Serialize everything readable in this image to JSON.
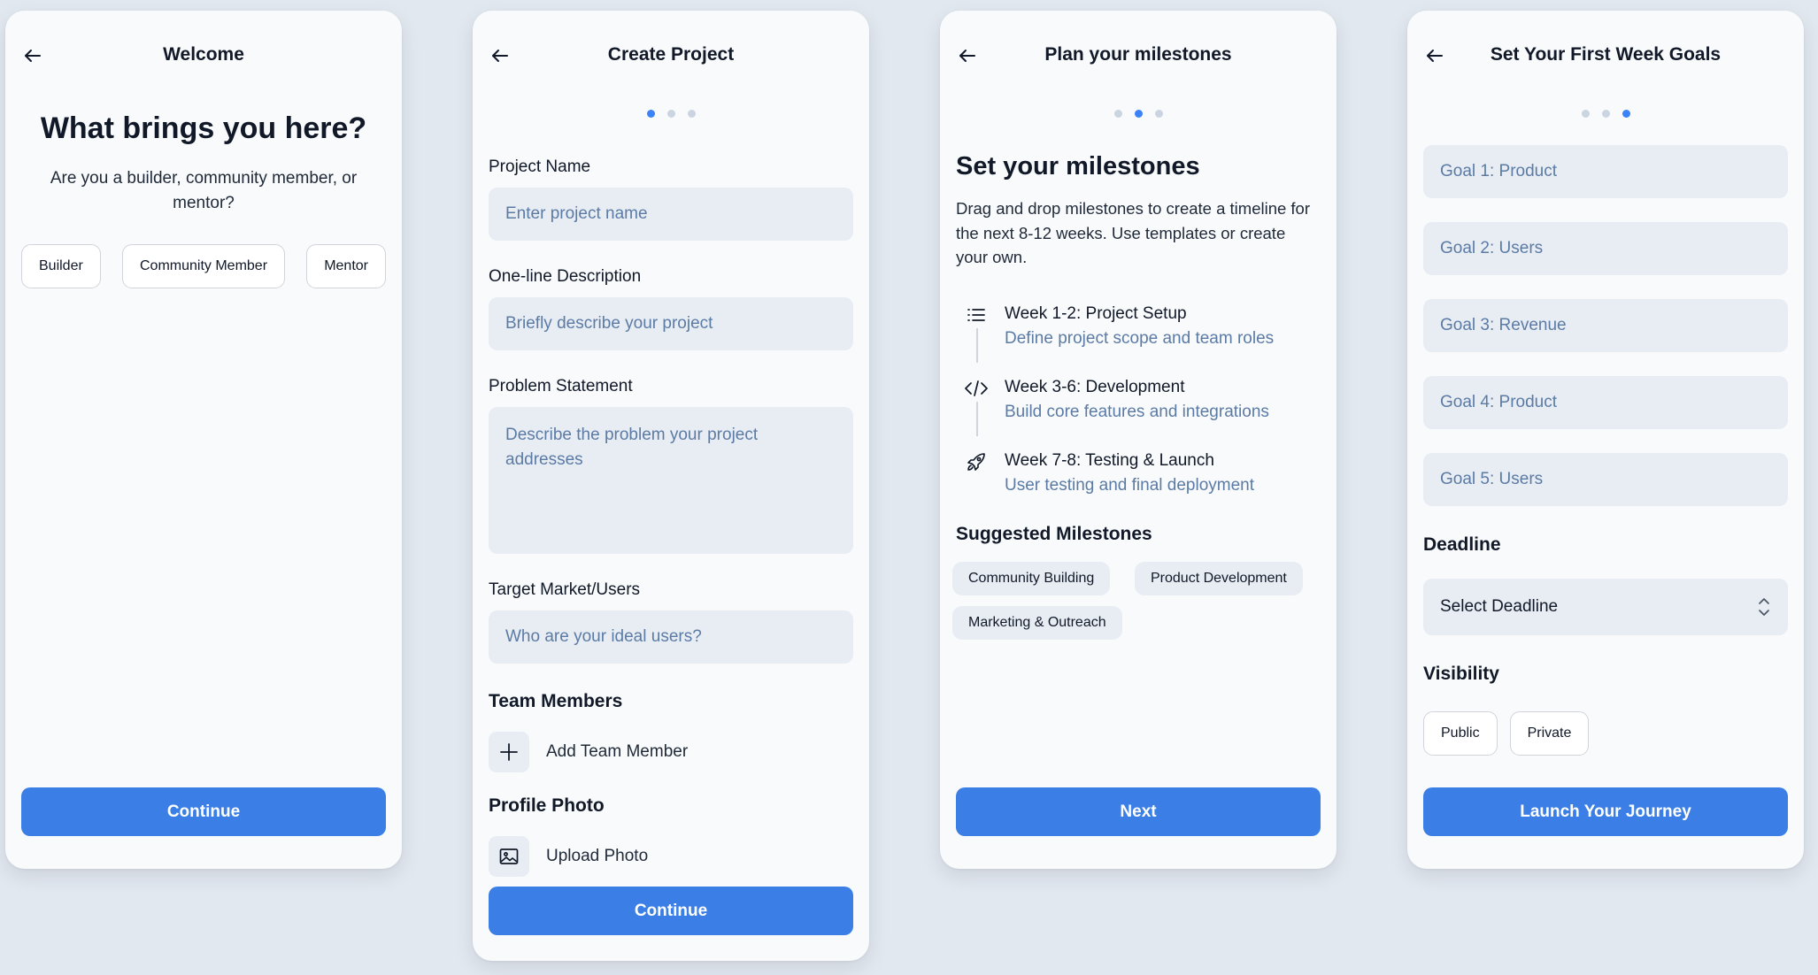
{
  "screens": {
    "welcome": {
      "title": "Welcome",
      "heading": "What brings you here?",
      "subtitle": "Are you a builder, community member, or mentor?",
      "roles": [
        "Builder",
        "Community Member",
        "Mentor"
      ],
      "continue_label": "Continue"
    },
    "create_project": {
      "title": "Create Project",
      "step": {
        "current": 1,
        "total": 3
      },
      "project_name": {
        "label": "Project Name",
        "placeholder": "Enter project name"
      },
      "description": {
        "label": "One-line Description",
        "placeholder": "Briefly describe your project"
      },
      "problem": {
        "label": "Problem Statement",
        "placeholder": "Describe the problem your project addresses"
      },
      "target": {
        "label": "Target Market/Users",
        "placeholder": "Who are your ideal users?"
      },
      "team_title": "Team Members",
      "add_member_label": "Add Team Member",
      "photo_title": "Profile Photo",
      "upload_label": "Upload Photo",
      "continue_label": "Continue"
    },
    "milestones": {
      "title": "Plan your milestones",
      "step": {
        "current": 2,
        "total": 3
      },
      "heading": "Set your milestones",
      "description": "Drag and drop milestones to create a timeline for the next 8-12 weeks. Use templates or create your own.",
      "timeline": [
        {
          "icon": "list-icon",
          "title": "Week 1-2: Project Setup",
          "subtitle": "Define project scope and team roles"
        },
        {
          "icon": "code-icon",
          "title": "Week 3-6: Development",
          "subtitle": "Build core features and integrations"
        },
        {
          "icon": "rocket-icon",
          "title": "Week 7-8: Testing & Launch",
          "subtitle": "User testing and final deployment"
        }
      ],
      "suggested_title": "Suggested Milestones",
      "suggested": [
        "Community Building",
        "Product Development",
        "Marketing & Outreach"
      ],
      "next_label": "Next"
    },
    "goals": {
      "title": "Set Your First Week Goals",
      "step": {
        "current": 3,
        "total": 3
      },
      "goals": [
        "Goal 1: Product",
        "Goal 2: Users",
        "Goal 3: Revenue",
        "Goal 4: Product",
        "Goal 5: Users"
      ],
      "deadline_title": "Deadline",
      "deadline_value": "Select Deadline",
      "visibility_title": "Visibility",
      "visibility_options": [
        "Public",
        "Private"
      ],
      "launch_label": "Launch Your Journey"
    }
  },
  "colors": {
    "background": "#e2e8f0",
    "card": "#f8fafc",
    "primary": "#3b7fe6",
    "input_fill": "#e8edf4",
    "placeholder": "#5b7ba5",
    "dot_active": "#3b82f6",
    "dot_inactive": "#cbd5e1"
  }
}
